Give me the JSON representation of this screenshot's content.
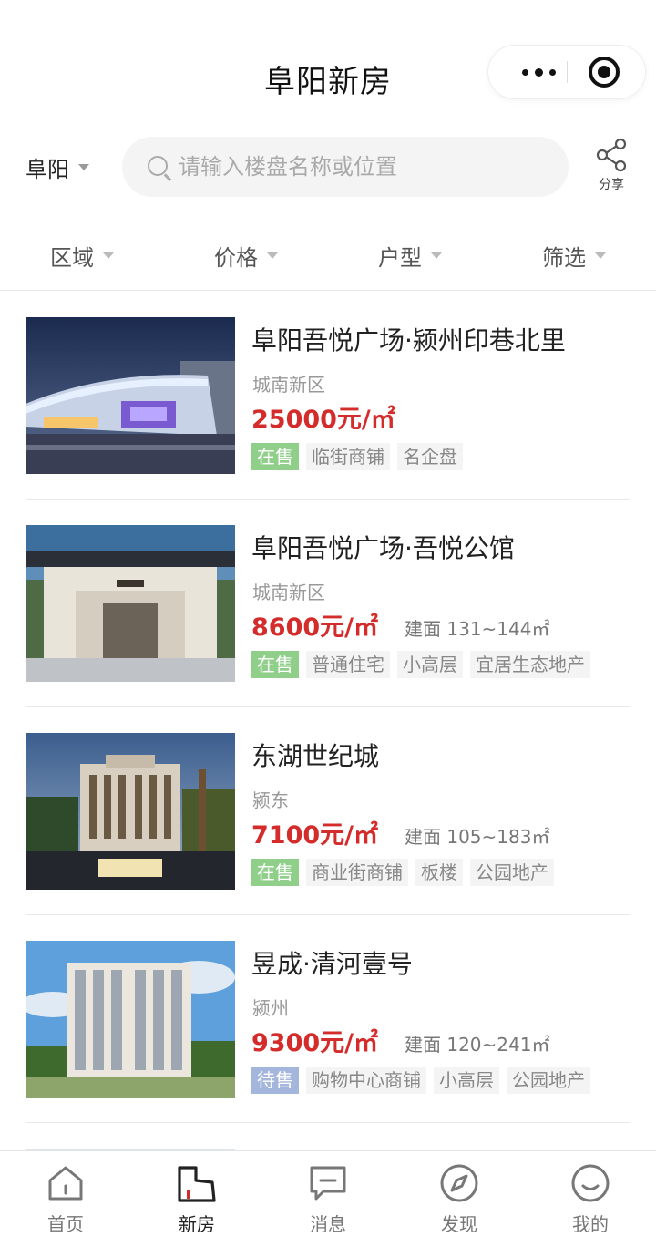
{
  "header": {
    "title": "阜阳新房"
  },
  "search": {
    "city": "阜阳",
    "placeholder": "请输入楼盘名称或位置",
    "share_label": "分享"
  },
  "filters": [
    "区域",
    "价格",
    "户型",
    "筛选"
  ],
  "listings": [
    {
      "name": "阜阳吾悦广场·颍州印巷北里",
      "district": "城南新区",
      "price": "25000元/㎡",
      "area": "",
      "status": "在售",
      "tags": [
        "临街商铺",
        "名企盘"
      ]
    },
    {
      "name": "阜阳吾悦广场·吾悦公馆",
      "district": "城南新区",
      "price": "8600元/㎡",
      "area": "建面 131~144㎡",
      "status": "在售",
      "tags": [
        "普通住宅",
        "小高层",
        "宜居生态地产"
      ]
    },
    {
      "name": "东湖世纪城",
      "district": "颍东",
      "price": "7100元/㎡",
      "area": "建面 105~183㎡",
      "status": "在售",
      "tags": [
        "商业街商铺",
        "板楼",
        "公园地产"
      ]
    },
    {
      "name": "昱成·清河壹号",
      "district": "颍州",
      "price": "9300元/㎡",
      "area": "建面 120~241㎡",
      "status": "待售",
      "tags": [
        "购物中心商铺",
        "小高层",
        "公园地产"
      ]
    }
  ],
  "tabbar": [
    {
      "label": "首页",
      "icon": "home-icon",
      "active": false
    },
    {
      "label": "新房",
      "icon": "building-icon",
      "active": true
    },
    {
      "label": "消息",
      "icon": "message-icon",
      "active": false
    },
    {
      "label": "发现",
      "icon": "compass-icon",
      "active": false
    },
    {
      "label": "我的",
      "icon": "smile-face-icon",
      "active": false
    }
  ],
  "colors": {
    "price": "#d42b2b",
    "status_sale": "#8fcf8a",
    "status_pre": "#a4b6dc"
  }
}
